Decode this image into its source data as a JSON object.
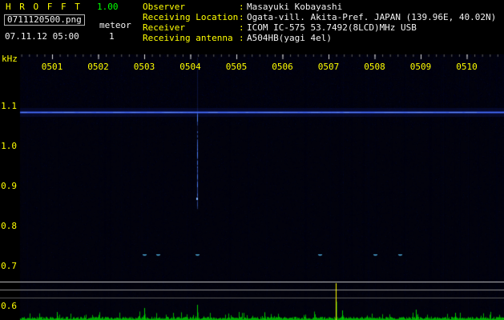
{
  "app": {
    "title": "H R O F F T",
    "version": "1.00",
    "filename": "0711120500.png",
    "mode_label": "meteor",
    "datetime": "07.11.12 05:00",
    "count": "1"
  },
  "info": {
    "separator": ":",
    "rows": [
      {
        "label": "Observer",
        "value": "Masayuki Kobayashi"
      },
      {
        "label": "Receiving Location",
        "value": "Ogata-vill. Akita-Pref. JAPAN (139.96E, 40.02N)"
      },
      {
        "label": "Receiver",
        "value": "ICOM IC-575 53.7492(8LCD)MHz USB"
      },
      {
        "label": "Receiving antenna",
        "value": "A504HB(yagi 4el)"
      }
    ]
  },
  "chart_data": {
    "type": "heatmap",
    "title": "HROFFT 10-minute meteor radio spectrogram with signal-level strip",
    "x_tick_labels": [
      "0501",
      "0502",
      "0503",
      "0504",
      "0505",
      "0506",
      "0507",
      "0508",
      "0509",
      "0510"
    ],
    "y_axis_unit": "kHz",
    "y_tick_labels": [
      "1.1",
      "1.0",
      "0.9",
      "0.8",
      "0.7",
      "0.6"
    ],
    "y_range_khz": [
      0.55,
      1.23
    ],
    "carrier_line_khz": 1.086,
    "meteor_echo": {
      "time_min": 4.15,
      "freq_khz_top": 1.09,
      "freq_khz_bottom": 0.86
    },
    "underdense_pings": {
      "freq_khz": 0.73,
      "times_min": [
        3.0,
        3.3,
        4.15,
        6.8,
        8.0,
        8.55
      ]
    },
    "level_spikes": [
      {
        "time_min": 1.1,
        "height": 10,
        "color": "#00c800"
      },
      {
        "time_min": 3.0,
        "height": 15,
        "color": "#00c800"
      },
      {
        "time_min": 4.15,
        "height": 19,
        "color": "#00c800"
      },
      {
        "time_min": 5.6,
        "height": 9,
        "color": "#00c800"
      },
      {
        "time_min": 7.15,
        "height": 46,
        "color": "#ffff00"
      },
      {
        "time_min": 7.3,
        "height": 12,
        "color": "#00c800"
      },
      {
        "time_min": 8.9,
        "height": 13,
        "color": "#00c800"
      },
      {
        "time_min": 9.75,
        "height": 9,
        "color": "#00c800"
      }
    ]
  },
  "colors": {
    "label_yellow": "#ffff00",
    "version_green": "#00ff00",
    "value_white": "#ffffff",
    "carrier_blue": "#4b73ff",
    "ping_cyan": "#5ac8ff",
    "level_green": "#00c800",
    "grid_bright": "#c8c8c8",
    "grid_mid": "#8c8c8c",
    "grid_dim": "#5a5a5a"
  },
  "render": {
    "noise_seed": 7
  }
}
